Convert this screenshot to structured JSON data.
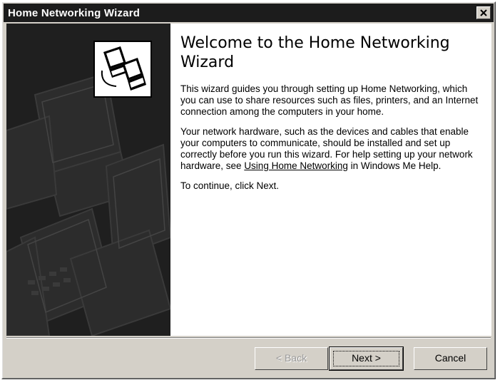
{
  "window": {
    "title": "Home Networking Wizard",
    "close_glyph": "×"
  },
  "main": {
    "heading": "Welcome to the Home Networking Wizard",
    "para1": "This wizard guides you through setting up Home Networking, which you can use to share resources such as files, printers, and an Internet connection among the computers in your home.",
    "para2_before": "Your network hardware, such as the devices and cables that enable your computers to communicate, should be installed and set up correctly before you run this wizard. For help setting up your network hardware, see ",
    "para2_link": "Using Home Networking",
    "para2_after": " in Windows Me Help.",
    "para3": "To continue, click Next."
  },
  "buttons": {
    "back": "< Back",
    "next": "Next >",
    "cancel": "Cancel"
  }
}
